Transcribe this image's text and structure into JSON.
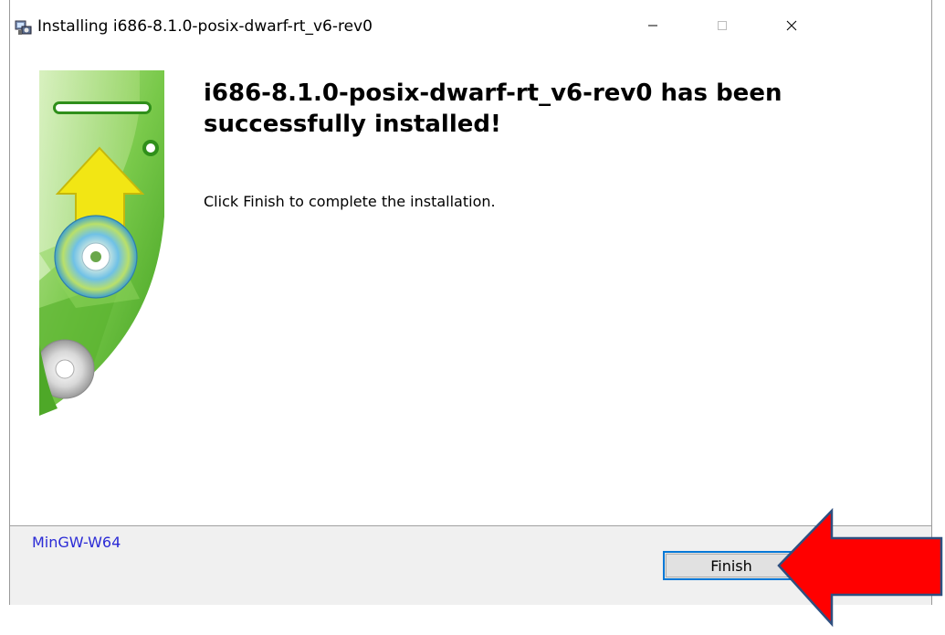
{
  "window": {
    "title": "Installing i686-8.1.0-posix-dwarf-rt_v6-rev0",
    "app_icon": "installer-icon",
    "controls": {
      "minimize_icon": "minimize-icon",
      "maximize_icon": "maximize-icon",
      "close_icon": "close-icon"
    }
  },
  "content": {
    "heading": "i686-8.1.0-posix-dwarf-rt_v6-rev0 has been successfully installed!",
    "instruction": "Click Finish to complete the installation."
  },
  "footer": {
    "brand": "MinGW-W64",
    "finish_label": "Finish"
  },
  "annotation": {
    "icon": "red-arrow-icon",
    "color": "#ff0000"
  },
  "colors": {
    "banner_green": "#55b82a",
    "banner_light_green": "#b7e08a",
    "arrow_yellow": "#f2e614",
    "brand_text": "#2b2bd6",
    "focus_border": "#0078d7"
  }
}
